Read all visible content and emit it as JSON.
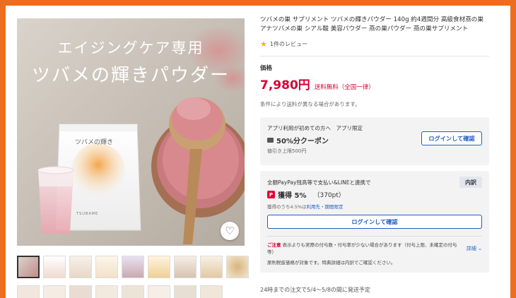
{
  "hero": {
    "title_line1": "エイジングケア専用",
    "title_line2": "ツバメの輝きパウダー",
    "pouch_title": "ツバメの輝き",
    "pouch_brand": "TSUBAME"
  },
  "product": {
    "title": "ツバメの巣 サプリメント ツバメの輝きパウダー 140g 約4週間分 高級食材燕の巣 アナツバメの巣 シアル酸 美容パウダー 燕の巣パウダー 燕の巣サプリメント",
    "review_text": "1件のレビュー",
    "price_label": "価格",
    "price": "7,980円",
    "shipping": "送料無料（全国一律）",
    "shipping_note": "条件により送料が異なる場合があります。"
  },
  "coupon": {
    "top": "アプリ利用が初めての方へ　アプリ限定",
    "title": "50%分クーポン",
    "sub": "値引き上限500円",
    "button": "ログインして確認"
  },
  "points": {
    "top": "全額PayPay残高等で支払い&LINEと連携で",
    "breakdown": "内訳",
    "earn_label": "獲得 5%",
    "earn_pt": "（370pt）",
    "sub_prefix": "獲得のうち4.5%は",
    "sub_link": "利用先・期間限定",
    "button": "ログインして確認",
    "caution_label": "ご注意",
    "caution_text": "表示よりも実際の付与数・付与率が少ない場合があります（付与上限、未確定の付与等）",
    "detail": "詳細",
    "tax_note": "原則税抜価格が対象です。特典詳細は内訳でご確認ください。"
  },
  "delivery": "24時までの注文で5/4〜5/8の間に発送予定"
}
